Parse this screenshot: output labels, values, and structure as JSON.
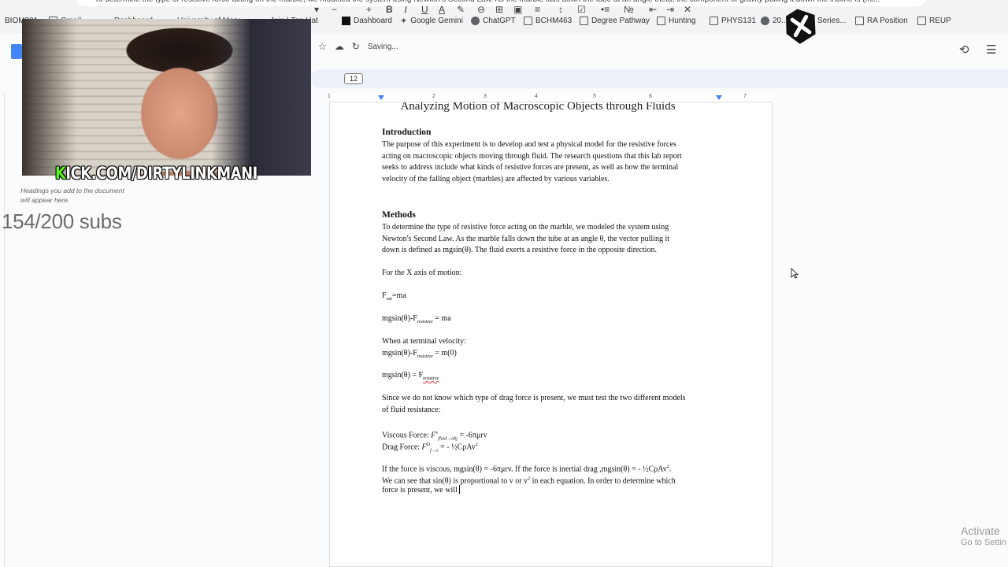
{
  "browser": {
    "address_snippet": "To determine the type of resistive force acting on the marble, we modeled the system using Newton's Second Law. As the marble falls down the tube at an angle theta, the component of gravity pulling it down the incline is (mi...",
    "bookmarks": [
      "BIOM201",
      "Gmail",
      "Dashboard",
      "University of Mary...",
      "Join | Top Hat",
      "Dashboard",
      "Google Gemini",
      "ChatGPT",
      "BCHM463",
      "Degree Pathway",
      "Hunting",
      "PHYS131",
      "20...",
      "Series...",
      "RA Position",
      "REUP"
    ]
  },
  "docs": {
    "status": "Saving...",
    "font_size": "12",
    "outline_hint_1": "Headings you add to the document",
    "outline_hint_2": "will appear here.",
    "ruler_numbers": [
      "1",
      "2",
      "3",
      "4",
      "5",
      "6",
      "7"
    ]
  },
  "overlay": {
    "kick_first": "K",
    "kick_rest": "ICK.COM/DIRTYLINKMANI",
    "subs": "154/200 subs"
  },
  "document": {
    "title": "Analyzing Motion of Macroscopic Objects through Fluids",
    "intro_heading": "Introduction",
    "intro_l1": " The purpose of this experiment is to develop and test a physical model for the resistive forces",
    "intro_l2": "acting on macroscopic objects moving through fluid. The research questions that this lab report",
    "intro_l3": "seeks to address include what kinds of resistive forces are present, as well as how the terminal",
    "intro_l4": "velocity of the falling object (marbles) are affected by various variables.",
    "methods_heading": "Methods",
    "m_l1": "To determine the type of resistive force acting on the marble, we modeled the system using",
    "m_l2": "Newton's Second Law. As the marble falls down the tube at an angle θ, the vector pulling it",
    "m_l3": "down is defined as mgsin(θ). The fluid exerts a resistive force in the opposite direction.",
    "x_axis": "For the X axis of motion:",
    "eq1_a": "F",
    "eq1_sub": "net",
    "eq1_b": "=ma",
    "eq2_a": "mgsin(θ)-F",
    "eq2_sub": "resistive",
    "eq2_b": " = ma",
    "terminal": "When at terminal velocity:",
    "eq3_a": "mgsin(θ)-F",
    "eq3_sub": "resistive",
    "eq3_b": " = m(0)",
    "eq4_a": "mgsin(θ) = F",
    "eq4_sub": "resistive",
    "since_l1": "Since we do not know which type of drag force is present, we must test the two different models",
    "since_l2": "of fluid resistance:",
    "viscous_a": "Viscous Force: ",
    "viscous_F": "F",
    "viscous_sup": "v",
    "viscous_sub": "fluid→obj",
    "viscous_b": " = -6πμrv",
    "drag_a": "Drag Force: ",
    "drag_F": "F",
    "drag_sup": "D",
    "drag_sub": "f→o",
    "drag_b": " = - ½CρAv",
    "drag_sq": "2",
    "if_l1_a": "If the force is viscous,  mgsin(θ) = -6πμrv. If the force is inertial drag ,mgsin(θ) =  - ½CρAv",
    "if_l1_sq": "2",
    "if_l1_b": ".",
    "if_l2_a": "We can see that sin(θ) is proportional to v or v",
    "if_l2_sq": "2",
    "if_l2_b": " in each equation. In order to determine which",
    "if_l3": "force is present, we will "
  },
  "windows": {
    "activate_line1": "Activate",
    "activate_line2": "Go to Settin"
  }
}
